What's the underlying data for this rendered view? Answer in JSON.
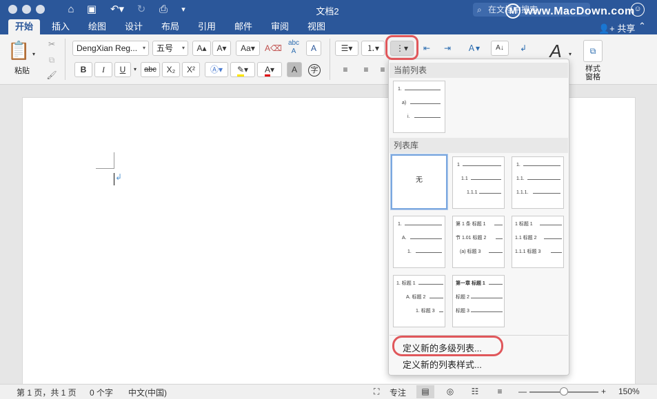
{
  "window": {
    "title": "文档2"
  },
  "search": {
    "placeholder": "在文档中搜索"
  },
  "watermark": {
    "text": "www.MacDown.com",
    "logo": "M"
  },
  "tabs": [
    {
      "label": "开始",
      "active": true
    },
    {
      "label": "插入"
    },
    {
      "label": "绘图"
    },
    {
      "label": "设计"
    },
    {
      "label": "布局"
    },
    {
      "label": "引用"
    },
    {
      "label": "邮件"
    },
    {
      "label": "审阅"
    },
    {
      "label": "视图"
    }
  ],
  "share_label": "共享",
  "ribbon": {
    "paste_label": "粘贴",
    "font_name": "DengXian Reg...",
    "font_size": "五号",
    "style_pane_label": "样式窗格",
    "bold": "B",
    "italic": "I",
    "underline": "U",
    "strike": "abc",
    "subscript": "X₂",
    "superscript": "X²",
    "char_border": "字"
  },
  "dropdown": {
    "current_header": "当前列表",
    "library_header": "列表库",
    "none_label": "无",
    "current": {
      "rows": [
        "1.",
        "a)",
        "i."
      ]
    },
    "library": [
      {
        "rows": [
          "1",
          "1.1",
          "1.1.1"
        ]
      },
      {
        "rows": [
          "1.",
          "1.1.",
          "1.1.1."
        ]
      },
      {
        "rows": [
          "1.",
          "A.",
          "1."
        ]
      },
      {
        "rows": [
          "第 1 条 标题 1",
          "节 1.01 标题 2",
          "(a) 标题 3"
        ]
      },
      {
        "rows": [
          "1 标题 1",
          "1.1 标题 2",
          "1.1.1 标题 3"
        ]
      },
      {
        "rows": [
          "1. 标题 1",
          "A. 标题 2",
          "1. 标题 3"
        ]
      },
      {
        "rows": [
          "第一章 标题 1",
          "标题 2",
          "标题 3"
        ]
      }
    ],
    "menu": {
      "define_list": "定义新的多级列表...",
      "define_style": "定义新的列表样式..."
    }
  },
  "status": {
    "page": "第 1 页，共 1 页",
    "words": "0 个字",
    "language": "中文(中国)",
    "focus": "专注",
    "zoom": "150%",
    "zoom_fraction": 0.5
  },
  "colors": {
    "brand": "#2b579a",
    "highlight": "#e0575b",
    "selected": "#7aa7e0"
  }
}
